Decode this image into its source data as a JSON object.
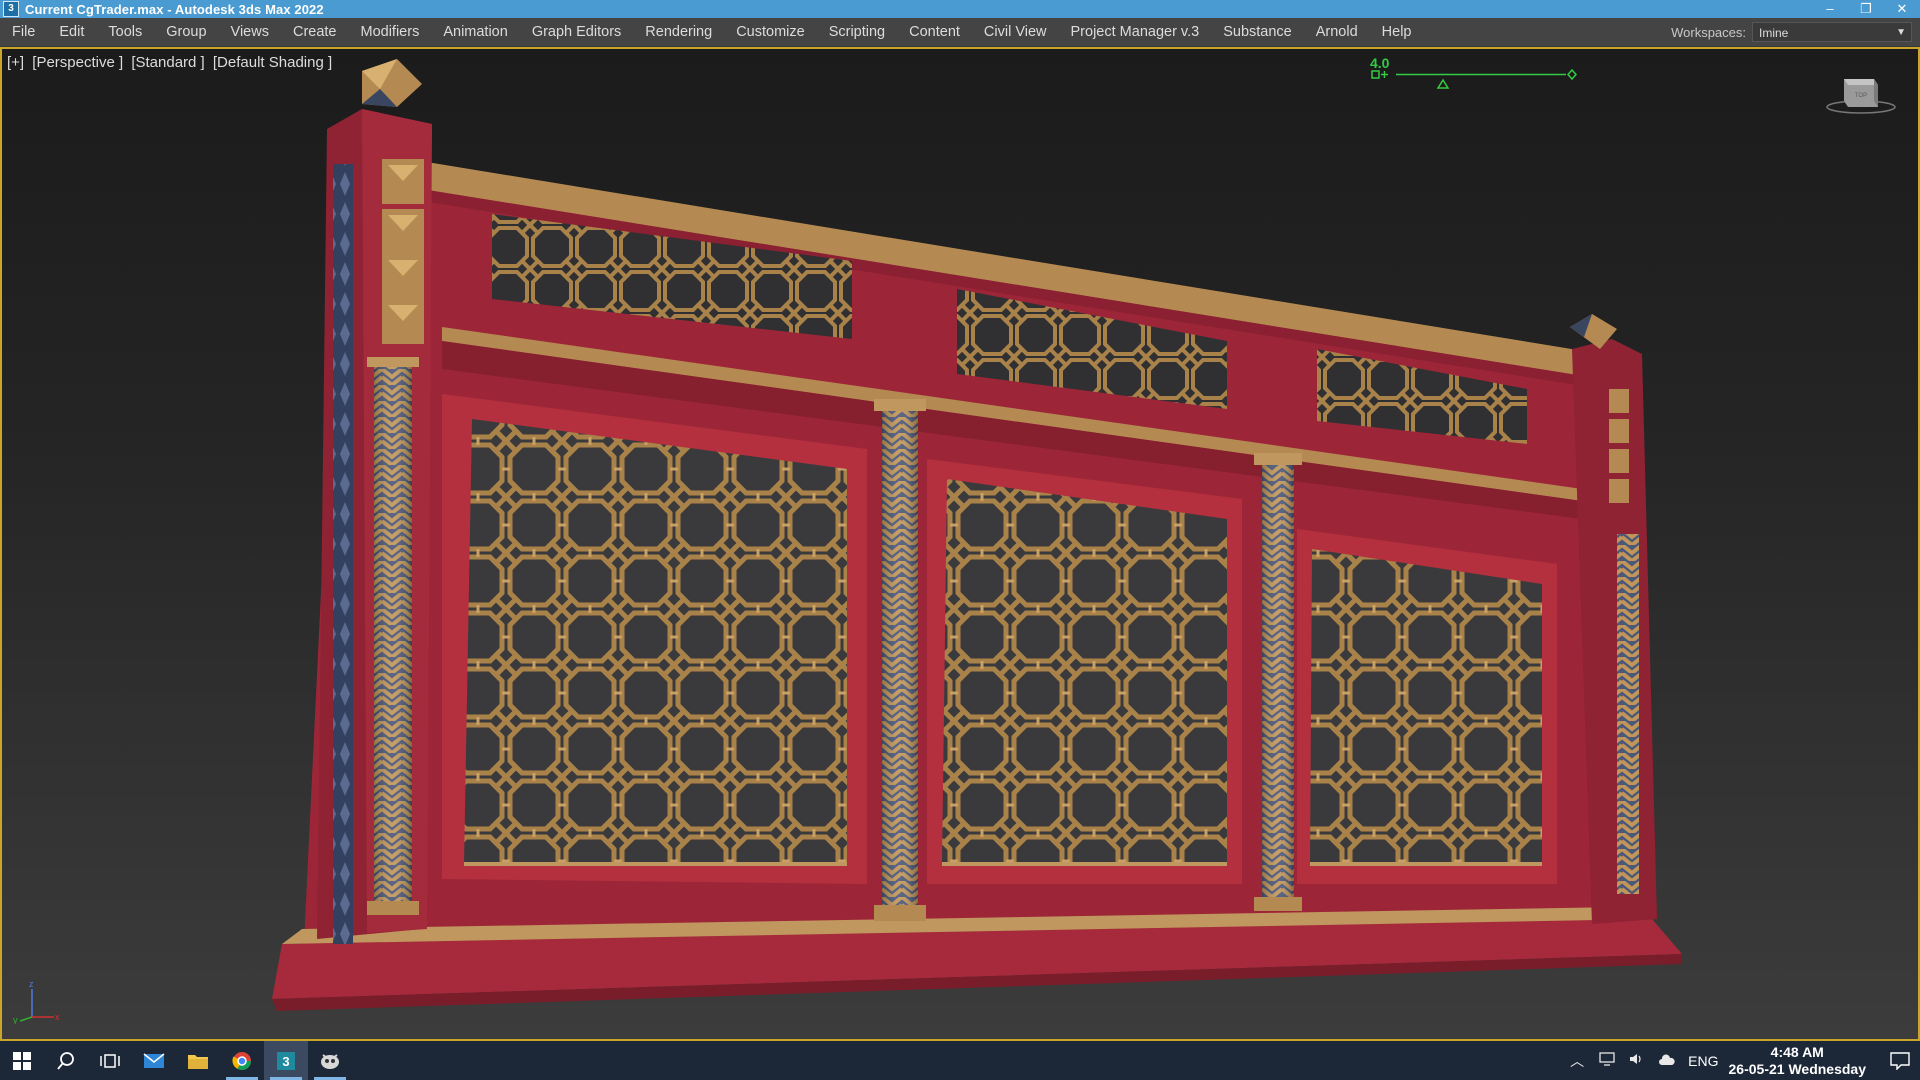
{
  "window": {
    "title": "Current CgTrader.max - Autodesk 3ds Max 2022",
    "app_icon_text": "3",
    "controls": [
      "–",
      "❐",
      "✕"
    ]
  },
  "menu": {
    "items": [
      "File",
      "Edit",
      "Tools",
      "Group",
      "Views",
      "Create",
      "Modifiers",
      "Animation",
      "Graph Editors",
      "Rendering",
      "Customize",
      "Scripting",
      "Content",
      "Civil View",
      "Project Manager v.3",
      "Substance",
      "Arnold",
      "Help"
    ],
    "workspaces_label": "Workspaces:",
    "workspaces_value": "Imine"
  },
  "viewport": {
    "label_plus": "[+]",
    "label_view": "[Perspective ]",
    "label_standard": "[Standard ]",
    "label_shading": "[Default Shading ]",
    "gizmo_value": "4.0",
    "axis_labels": {
      "x": "x",
      "y": "y",
      "z": "z"
    },
    "colors": {
      "frame": "#c9a62a",
      "railing": "#a02a3c",
      "ornament": "#b08a4a",
      "pillar_blue": "#3c4a6a"
    }
  },
  "taskbar": {
    "apps": [
      "windows-start",
      "search",
      "task-view",
      "mail",
      "file-explorer",
      "chrome",
      "3ds-max",
      "app-extra"
    ],
    "tray_language": "ENG",
    "time": "4:48 AM",
    "date": "26-05-21 Wednesday"
  }
}
